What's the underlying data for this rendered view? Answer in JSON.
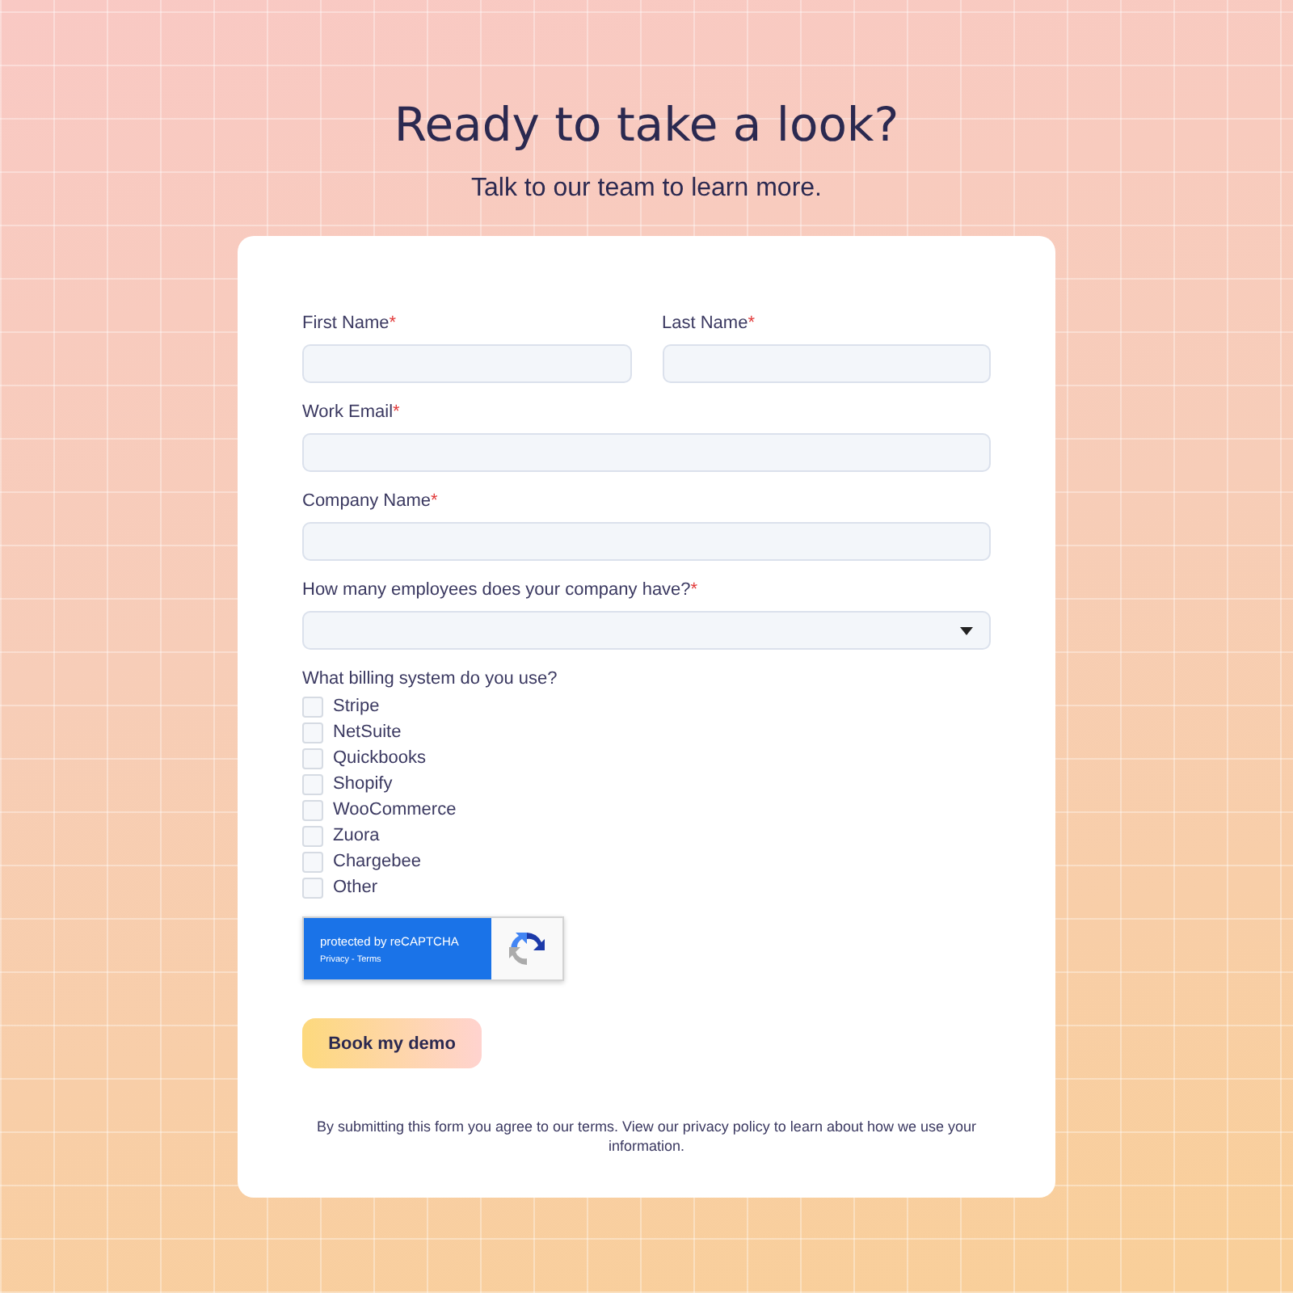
{
  "heading": "Ready to take a look?",
  "subheading": "Talk to our team to learn more.",
  "form": {
    "name_row": [
      {
        "label": "First Name",
        "required_mark": "*"
      },
      {
        "label": "Last Name",
        "required_mark": "*"
      }
    ],
    "fields": [
      {
        "label": "Work Email",
        "required_mark": "*",
        "kind": "text"
      },
      {
        "label": "Company Name",
        "required_mark": "*",
        "kind": "text"
      },
      {
        "label": "How many employees does your company have?",
        "required_mark": "*",
        "kind": "select"
      }
    ],
    "billing": {
      "label": "What billing system do you use?",
      "options": [
        {
          "label": "Stripe",
          "checked": false
        },
        {
          "label": "NetSuite",
          "checked": false
        },
        {
          "label": "Quickbooks",
          "checked": false
        },
        {
          "label": "Shopify",
          "checked": false
        },
        {
          "label": "WooCommerce",
          "checked": false
        },
        {
          "label": "Zuora",
          "checked": false
        },
        {
          "label": "Chargebee",
          "checked": false
        },
        {
          "label": "Other",
          "checked": false
        }
      ]
    },
    "recaptcha": {
      "text": "protected by reCAPTCHA",
      "links": "Privacy - Terms"
    },
    "submit": "Book my demo",
    "disclaimer": "By submitting this form you agree to our terms. View our privacy policy to learn about how we use your information."
  }
}
